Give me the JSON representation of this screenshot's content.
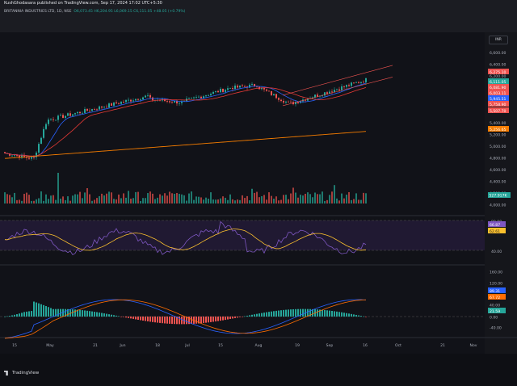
{
  "header": {
    "publisher": "KushGhodasara published on TradingView.com, Sep 17, 2024 17:02 UTC+5:30",
    "symbol": "BRITANNIA INDUSTRIES LTD, 1D, NSE",
    "ohlc": "O6,073.45  H6,204.95  L6,069.15  C6,111.05  +48.05 (+0.79%)",
    "currency": "INR"
  },
  "colors": {
    "up": "#26a69a",
    "down": "#ef5350",
    "ma_fast": "#2962ff",
    "ma_mid": "#e53935",
    "ma_slow": "#f57c00",
    "rsi": "#7e57c2",
    "rsi_signal": "#fbc02d",
    "macd": "#2962ff",
    "macd_signal": "#ff6d00"
  },
  "price_axis": [
    "6,600.00",
    "6,400.00",
    "6,200.00",
    "6,000.00",
    "5,800.00",
    "5,600.00",
    "5,400.00",
    "5,200.00",
    "5,000.00",
    "4,800.00",
    "4,600.00",
    "4,400.00",
    "4,200.00",
    "4,000.00"
  ],
  "price_tags": [
    {
      "label": "6,275.10",
      "color": "#ef5350"
    },
    {
      "label": "6,111.05",
      "color": "#26a69a"
    },
    {
      "label": "6,081.90",
      "color": "#ef5350"
    },
    {
      "label": "6,003.11",
      "color": "#ef5350"
    },
    {
      "label": "5,945.51",
      "color": "#2962ff"
    },
    {
      "label": "5,758.90",
      "color": "#ef5350"
    },
    {
      "label": "5,507.70",
      "color": "#ef5350"
    },
    {
      "label": "5,256.65",
      "color": "#f57c00"
    }
  ],
  "volume_tag": "527.917K",
  "rsi_axis": [
    "80.00",
    "40.00"
  ],
  "rsi_tags": [
    {
      "label": "66.87",
      "color": "#7e57c2"
    },
    {
      "label": "62.61",
      "color": "#fbc02d"
    }
  ],
  "macd_axis": [
    "160.00",
    "120.00",
    "40.00",
    "0.00",
    "-40.00"
  ],
  "macd_tags": [
    {
      "label": "89.31",
      "color": "#2962ff"
    },
    {
      "label": "67.72",
      "color": "#ff6d00"
    },
    {
      "label": "21.59",
      "color": "#26a69a"
    }
  ],
  "time_axis": [
    "15",
    "May",
    "21",
    "Jun",
    "18",
    "Jul",
    "15",
    "Aug",
    "19",
    "Sep",
    "16",
    "Oct",
    "21",
    "Nov"
  ],
  "brand": "TradingView"
}
